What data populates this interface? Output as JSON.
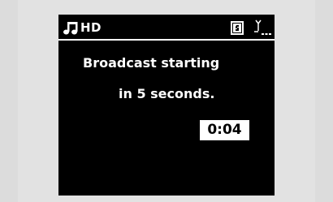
{
  "status_bar": {
    "source_label": "HD",
    "icons": [
      "music-note-icon",
      "battery-icon",
      "signal-antenna-icon"
    ]
  },
  "message": {
    "line1": "Broadcast starting",
    "line2": "in 5 seconds."
  },
  "countdown": {
    "time": "0:04"
  },
  "colors": {
    "screen_background": "#000000",
    "text": "#ffffff",
    "outer_background": "#dcdcdc"
  }
}
